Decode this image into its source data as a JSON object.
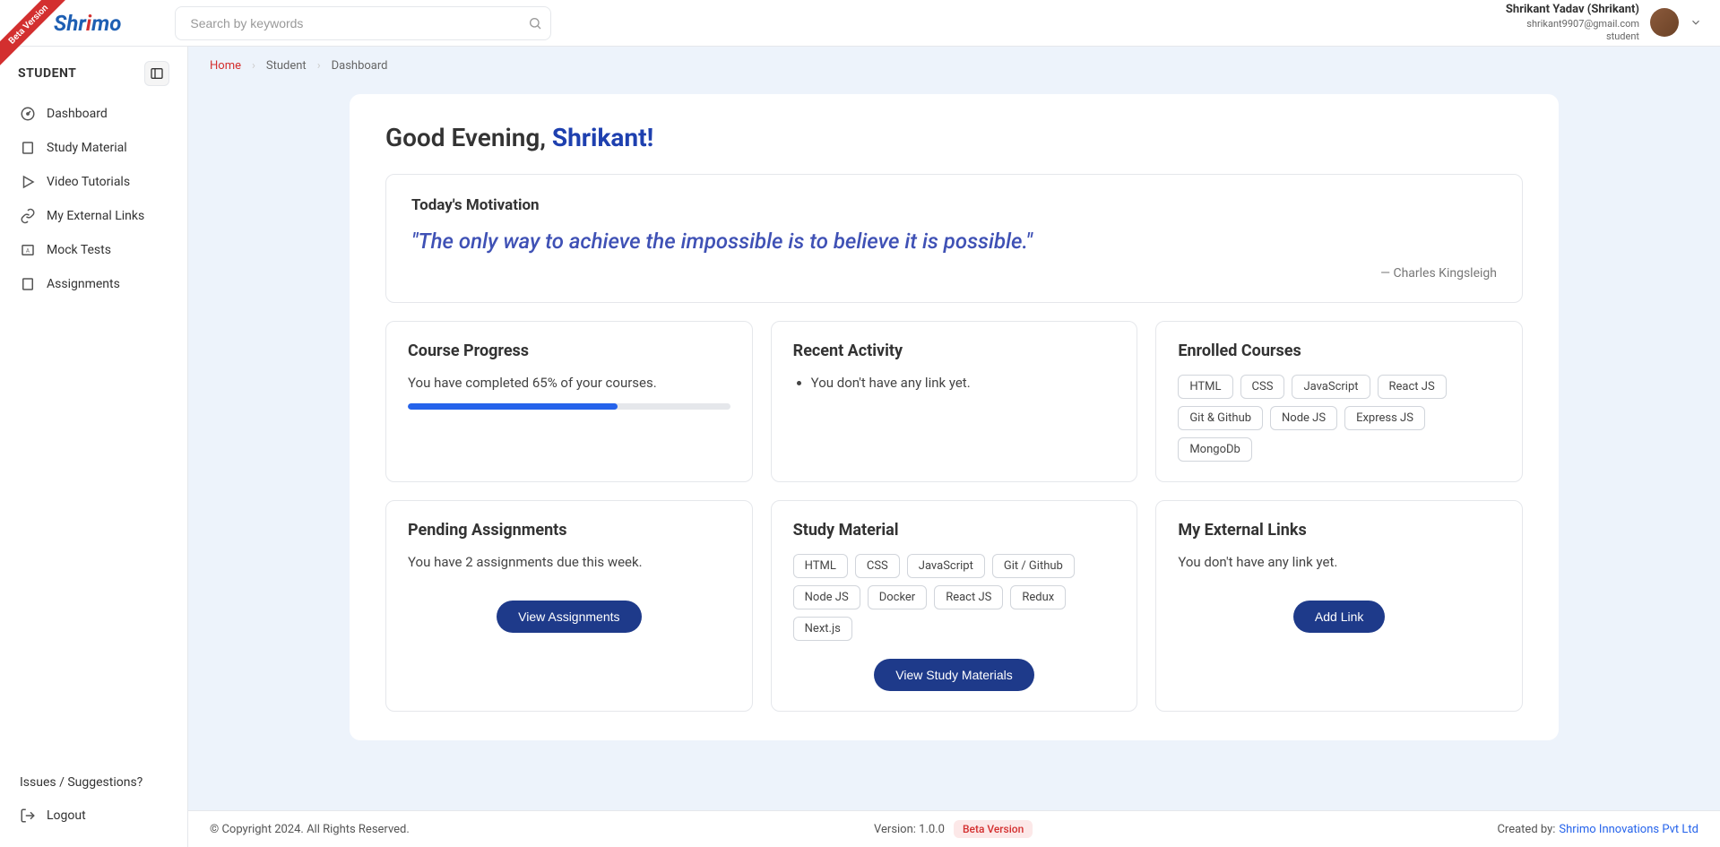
{
  "beta_ribbon": "Beta Version",
  "logo": {
    "part1": "Shr",
    "part2": "i",
    "part3": "mo"
  },
  "search": {
    "placeholder": "Search by keywords"
  },
  "user": {
    "name": "Shrikant Yadav (Shrikant)",
    "email": "shrikant9907@gmail.com",
    "role": "student"
  },
  "sidebar": {
    "title": "STUDENT",
    "items": [
      {
        "label": "Dashboard"
      },
      {
        "label": "Study Material"
      },
      {
        "label": "Video Tutorials"
      },
      {
        "label": "My External Links"
      },
      {
        "label": "Mock Tests"
      },
      {
        "label": "Assignments"
      }
    ],
    "footer": [
      {
        "label": "Issues / Suggestions?"
      },
      {
        "label": "Logout"
      }
    ]
  },
  "breadcrumb": {
    "home": "Home",
    "mid": "Student",
    "leaf": "Dashboard"
  },
  "greeting": {
    "prefix": "Good Evening, ",
    "name": "Shrikant!"
  },
  "motivation": {
    "title": "Today's Motivation",
    "quote": "\"The only way to achieve the impossible is to believe it is possible.\"",
    "author": "— Charles Kingsleigh"
  },
  "progress": {
    "title": "Course Progress",
    "text": "You have completed 65% of your courses.",
    "percent": 65
  },
  "activity": {
    "title": "Recent Activity",
    "items": [
      "You don't have any link yet."
    ]
  },
  "enrolled": {
    "title": "Enrolled Courses",
    "chips": [
      "HTML",
      "CSS",
      "JavaScript",
      "React JS",
      "Git & Github",
      "Node JS",
      "Express JS",
      "MongoDb"
    ]
  },
  "pending": {
    "title": "Pending Assignments",
    "text": "You have 2 assignments due this week.",
    "button": "View Assignments"
  },
  "study": {
    "title": "Study Material",
    "chips": [
      "HTML",
      "CSS",
      "JavaScript",
      "Git / Github",
      "Node JS",
      "Docker",
      "React JS",
      "Redux",
      "Next.js"
    ],
    "button": "View Study Materials"
  },
  "links": {
    "title": "My External Links",
    "text": "You don't have any link yet.",
    "button": "Add Link"
  },
  "footer": {
    "copyright": "© Copyright 2024. All Rights Reserved.",
    "version_label": "Version: ",
    "version": "1.0.0",
    "beta": "Beta Version",
    "created_by": "Created by: ",
    "company": "Shrimo Innovations Pvt Ltd"
  }
}
